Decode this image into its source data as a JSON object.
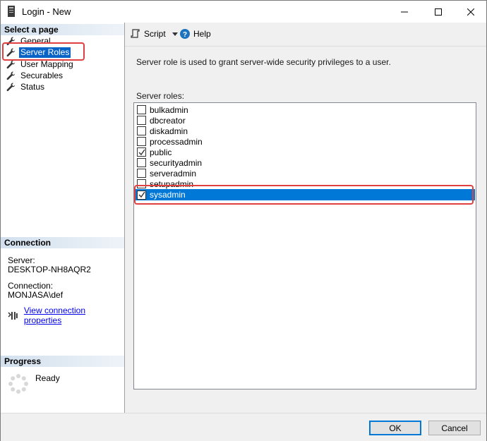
{
  "window": {
    "title": "Login - New"
  },
  "left": {
    "select_page_header": "Select a page",
    "pages": [
      {
        "label": "General",
        "selected": false
      },
      {
        "label": "Server Roles",
        "selected": true
      },
      {
        "label": "User Mapping",
        "selected": false
      },
      {
        "label": "Securables",
        "selected": false
      },
      {
        "label": "Status",
        "selected": false
      }
    ],
    "connection_header": "Connection",
    "server_label": "Server:",
    "server_value": "DESKTOP-NH8AQR2",
    "connection_label": "Connection:",
    "connection_value": "MONJASA\\def",
    "view_props_link": "View connection properties",
    "progress_header": "Progress",
    "progress_status": "Ready"
  },
  "toolbar": {
    "script_label": "Script",
    "help_label": "Help"
  },
  "main": {
    "description": "Server role is used to grant server-wide security privileges to a user.",
    "roles_label": "Server roles:",
    "roles": [
      {
        "name": "bulkadmin",
        "checked": false
      },
      {
        "name": "dbcreator",
        "checked": false
      },
      {
        "name": "diskadmin",
        "checked": false
      },
      {
        "name": "processadmin",
        "checked": false
      },
      {
        "name": "public",
        "checked": true
      },
      {
        "name": "securityadmin",
        "checked": false
      },
      {
        "name": "serveradmin",
        "checked": false
      },
      {
        "name": "setupadmin",
        "checked": false
      },
      {
        "name": "sysadmin",
        "checked": true,
        "selected": true
      }
    ]
  },
  "footer": {
    "ok_label": "OK",
    "cancel_label": "Cancel"
  },
  "colors": {
    "selection": "#0078d7",
    "highlight_box": "#e04040",
    "link": "#0000ee"
  }
}
